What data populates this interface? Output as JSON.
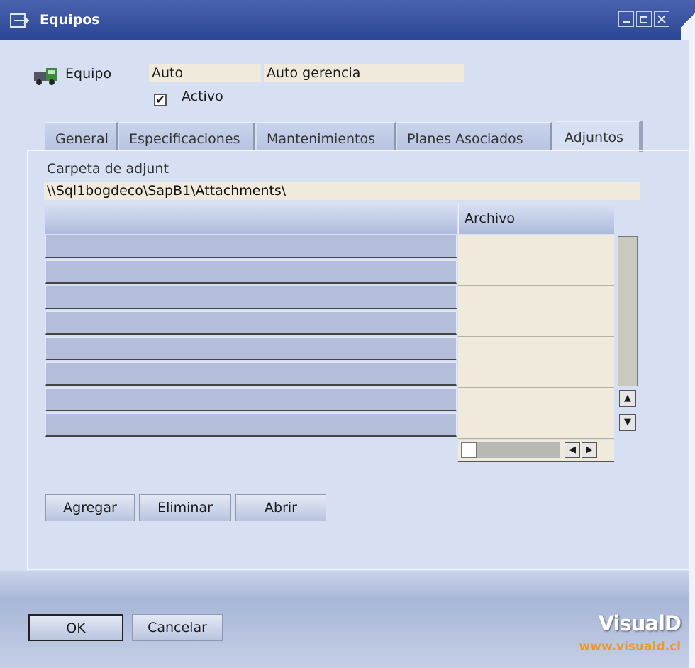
{
  "window": {
    "title": "Equipos"
  },
  "header": {
    "equipo_label": "Equipo",
    "equipo_code": "Auto",
    "equipo_name": "Auto gerencia",
    "activo_label": "Activo",
    "activo_checked": true
  },
  "tabs": [
    {
      "label": "General"
    },
    {
      "label": "Especificaciones"
    },
    {
      "label": "Mantenimientos"
    },
    {
      "label": "Planes Asociados"
    },
    {
      "label": "Adjuntos",
      "active": true
    }
  ],
  "attachments": {
    "folder_label": "Carpeta de adjunt",
    "folder_path": "\\\\Sql1bogdeco\\SapB1\\Attachments\\",
    "column_file": "Archivo",
    "buttons": {
      "add": "Agregar",
      "delete": "Eliminar",
      "open": "Abrir"
    }
  },
  "footer": {
    "ok": "OK",
    "cancel": "Cancelar"
  },
  "brand": {
    "name": "VisualD",
    "url": "www.visuald.cl",
    "accent": "#e89a2c"
  }
}
